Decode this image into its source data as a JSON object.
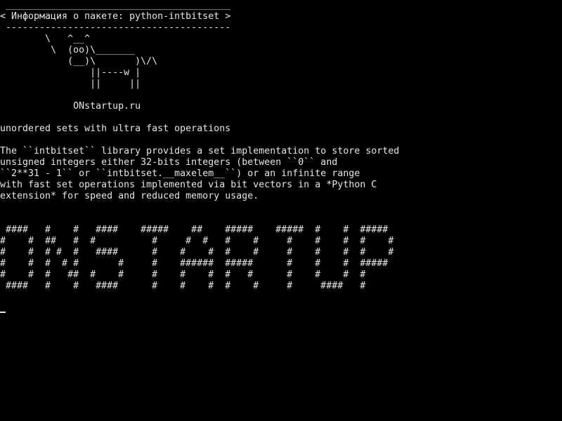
{
  "screen": {
    "background_color": "#000000",
    "text_color": "#e6e6e6"
  },
  "cowsay": {
    "border_top": " ________________________________________",
    "message": "< Информация о пакете: python-intbitset >",
    "border_bottom": " ----------------------------------------",
    "cow_lines": [
      "        \\   ^__^",
      "         \\  (oo)\\_______",
      "            (__)\\       )\\/\\",
      "                ||----w |",
      "                ||     ||"
    ]
  },
  "site": "             ONstartup.ru",
  "summary": "unordered sets with ultra fast operations",
  "description_lines": [
    "The ``intbitset`` library provides a set implementation to store sorted",
    "unsigned integers either 32-bits integers (between ``0`` and",
    "``2**31 - 1`` or ``intbitset.__maxelem__``) or an infinite range",
    "with fast set operations implemented via bit vectors in a *Python C",
    "extension* for speed and reduced memory usage."
  ],
  "banner_lines": [
    " ####   #    #   ####    #####    ##    #####    #####  #    #  #####",
    "#    #  ##   #  #          #     #  #   #    #     #    #    #  #    #",
    "#    #  # #  #   ####      #    #    #  #    #     #    #    #  #    #",
    "#    #  #  # #       #     #    ######  #####      #    #    #  #####",
    "#    #  #   ##  #    #     #    #    #  #   #      #    #    #  #",
    " ####   #    #   ####      #    #    #  #    #     #     ####   #"
  ]
}
